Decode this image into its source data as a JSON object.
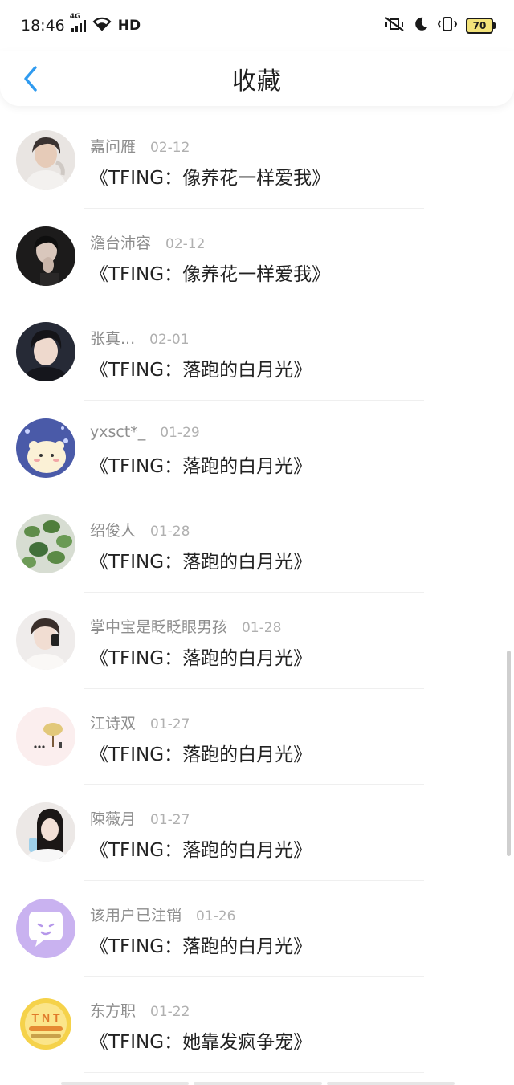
{
  "status_bar": {
    "time": "18:46",
    "network": "4G",
    "hd": "HD",
    "battery": "70"
  },
  "header": {
    "title": "收藏"
  },
  "items": [
    {
      "name": "嘉问雁",
      "date": "02-12",
      "work": "《TFING：像养花一样爱我》",
      "avatar": "user-photo"
    },
    {
      "name": "澹台沛容",
      "date": "02-12",
      "work": "《TFING：像养花一样爱我》",
      "avatar": "user-photo"
    },
    {
      "name": "张真...",
      "date": "02-01",
      "work": "《TFING：落跑的白月光》",
      "avatar": "user-photo"
    },
    {
      "name": "yxsct*_",
      "date": "01-29",
      "work": "《TFING：落跑的白月光》",
      "avatar": "cartoon-hamster"
    },
    {
      "name": "绍俊人",
      "date": "01-28",
      "work": "《TFING：落跑的白月光》",
      "avatar": "plant-leaves"
    },
    {
      "name": "掌中宝是眨眨眼男孩",
      "date": "01-28",
      "work": "《TFING：落跑的白月光》",
      "avatar": "user-photo"
    },
    {
      "name": "江诗双",
      "date": "01-27",
      "work": "《TFING：落跑的白月光》",
      "avatar": "tree-drawing"
    },
    {
      "name": "陳薇月",
      "date": "01-27",
      "work": "《TFING：落跑的白月光》",
      "avatar": "user-photo"
    },
    {
      "name": "该用户已注销",
      "date": "01-26",
      "work": "《TFING：落跑的白月光》",
      "avatar": "chat-bubble"
    },
    {
      "name": "东方职",
      "date": "01-22",
      "work": "《TFING：她靠发疯争宠》",
      "avatar": "tnt-logo"
    }
  ],
  "colors": {
    "accent": "#2f9bf0",
    "name_text": "#8e8e8e",
    "date_text": "#b0b0b0",
    "work_text": "#222222"
  }
}
